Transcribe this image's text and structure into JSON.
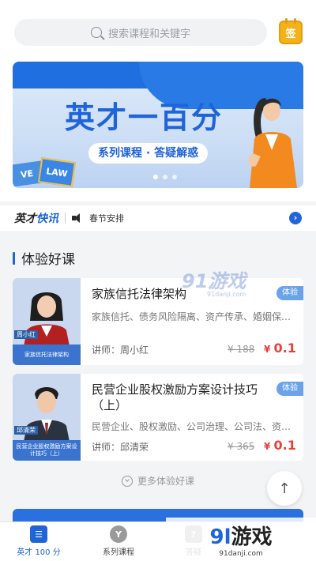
{
  "search": {
    "placeholder": "搜索课程和关键字"
  },
  "sign_in": {
    "label": "签",
    "icon": "calendar-sign-icon"
  },
  "banner": {
    "title": "英才一百分",
    "subtitle": "系列课程 · 答疑解惑",
    "book1": "VE",
    "book2": "LAW",
    "slide_count": 3,
    "active_slide": 1
  },
  "notice": {
    "logo_a": "英才",
    "logo_b": "快讯",
    "text": "春节安排",
    "go": "›"
  },
  "section": {
    "title": "体验好课",
    "more": "更多体验好课"
  },
  "courses": [
    {
      "title": "家族信托法律架构",
      "tags": "家族信托、债务风险隔离、资产传承、婚姻保护...",
      "teacher": "讲师：周小红",
      "price_old": "¥ 188",
      "price_currency": "¥ ",
      "price_new": "0.1",
      "badge": "体验",
      "thumb_name": "周小红",
      "thumb_caption": "家族信托法律架构"
    },
    {
      "title": "民营企业股权激励方案设计技巧（上）",
      "tags": "民营企业、股权激励、公司治理、公司法、资本...",
      "teacher": "讲师：邱清荣",
      "price_old": "¥ 365",
      "price_currency": "¥ ",
      "price_new": "0.1",
      "badge": "体验",
      "thumb_name": "邱清荣",
      "thumb_caption": "民营企业股权激励方案设计技巧（上）"
    }
  ],
  "back_to_top": "↑",
  "tabs": [
    {
      "label": "英才 100 分",
      "icon": "home-book-icon",
      "active": true
    },
    {
      "label": "系列课程",
      "icon": "bulb-icon",
      "active": false
    },
    {
      "label": "答疑",
      "icon": "qa-icon",
      "active": false
    }
  ],
  "watermark": {
    "center": "91游戏",
    "center_sub": "91danji.com",
    "corner_a": "9l",
    "corner_b": "游戏",
    "corner_sub": "91danji.com"
  },
  "colors": {
    "accent": "#1f64d8",
    "price": "#e8403a",
    "sign": "#f3b21a"
  }
}
